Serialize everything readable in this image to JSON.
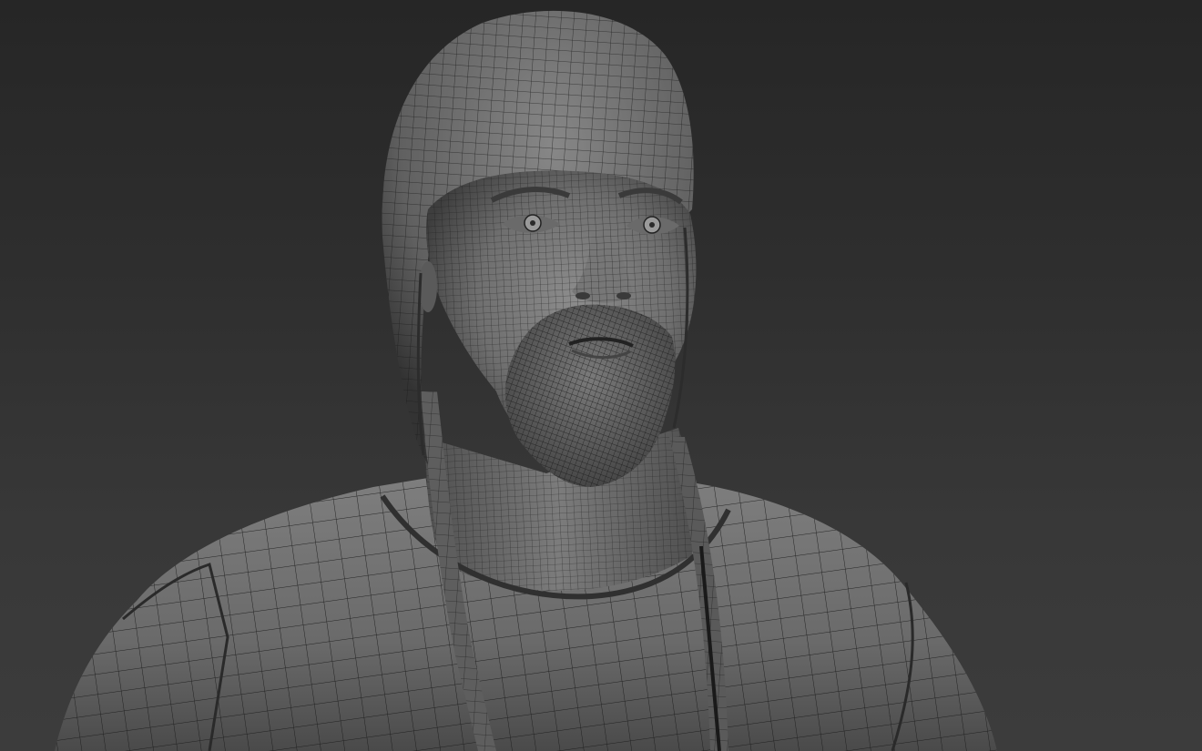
{
  "scene": {
    "subject": "bearded-man-bust",
    "render_mode": "shaded-wireframe"
  },
  "colors": {
    "background_top": "#262626",
    "background_bottom": "#3c3c3c",
    "surface_light": "#8a8a8a",
    "surface_mid": "#6e6e6e",
    "surface_dark": "#3a3a3a",
    "wire": "#1c1c1c"
  }
}
